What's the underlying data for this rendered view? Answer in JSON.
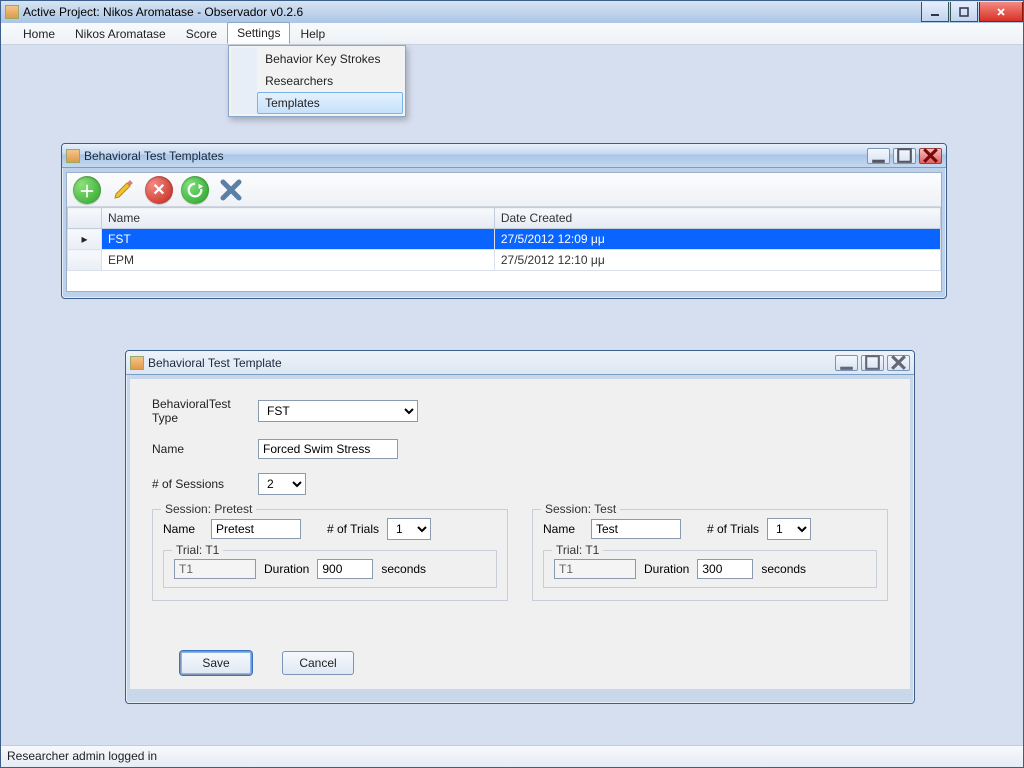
{
  "window": {
    "title": "Active Project: Nikos Aromatase - Observador v0.2.6"
  },
  "menubar": {
    "items": [
      "Home",
      "Nikos Aromatase",
      "Score",
      "Settings",
      "Help"
    ],
    "open_index": 3
  },
  "settings_menu": {
    "items": [
      "Behavior Key Strokes",
      "Researchers",
      "Templates"
    ],
    "hover_index": 2
  },
  "templates_window": {
    "title": "Behavioral Test Templates",
    "columns": {
      "name": "Name",
      "date": "Date Created"
    },
    "rows": [
      {
        "name": "FST",
        "date": "27/5/2012 12:09 μμ",
        "selected": true
      },
      {
        "name": "EPM",
        "date": "27/5/2012 12:10 μμ",
        "selected": false
      }
    ]
  },
  "template_form": {
    "title": "Behavioral Test Template",
    "labels": {
      "type": "BehavioralTest Type",
      "name": "Name",
      "sessions": "# of Sessions",
      "session_name": "Name",
      "trials": "# of Trials",
      "duration": "Duration",
      "seconds": "seconds"
    },
    "values": {
      "type": "FST",
      "name": "Forced Swim Stress",
      "sessions": "2"
    },
    "session1": {
      "title": "Session: Pretest",
      "name": "Pretest",
      "trials": "1",
      "trial_title": "Trial: T1",
      "trial_name": "T1",
      "duration": "900"
    },
    "session2": {
      "title": "Session: Test",
      "name": "Test",
      "trials": "1",
      "trial_title": "Trial: T1",
      "trial_name": "T1",
      "duration": "300"
    },
    "buttons": {
      "save": "Save",
      "cancel": "Cancel"
    }
  },
  "statusbar": {
    "text": "Researcher admin logged in"
  }
}
